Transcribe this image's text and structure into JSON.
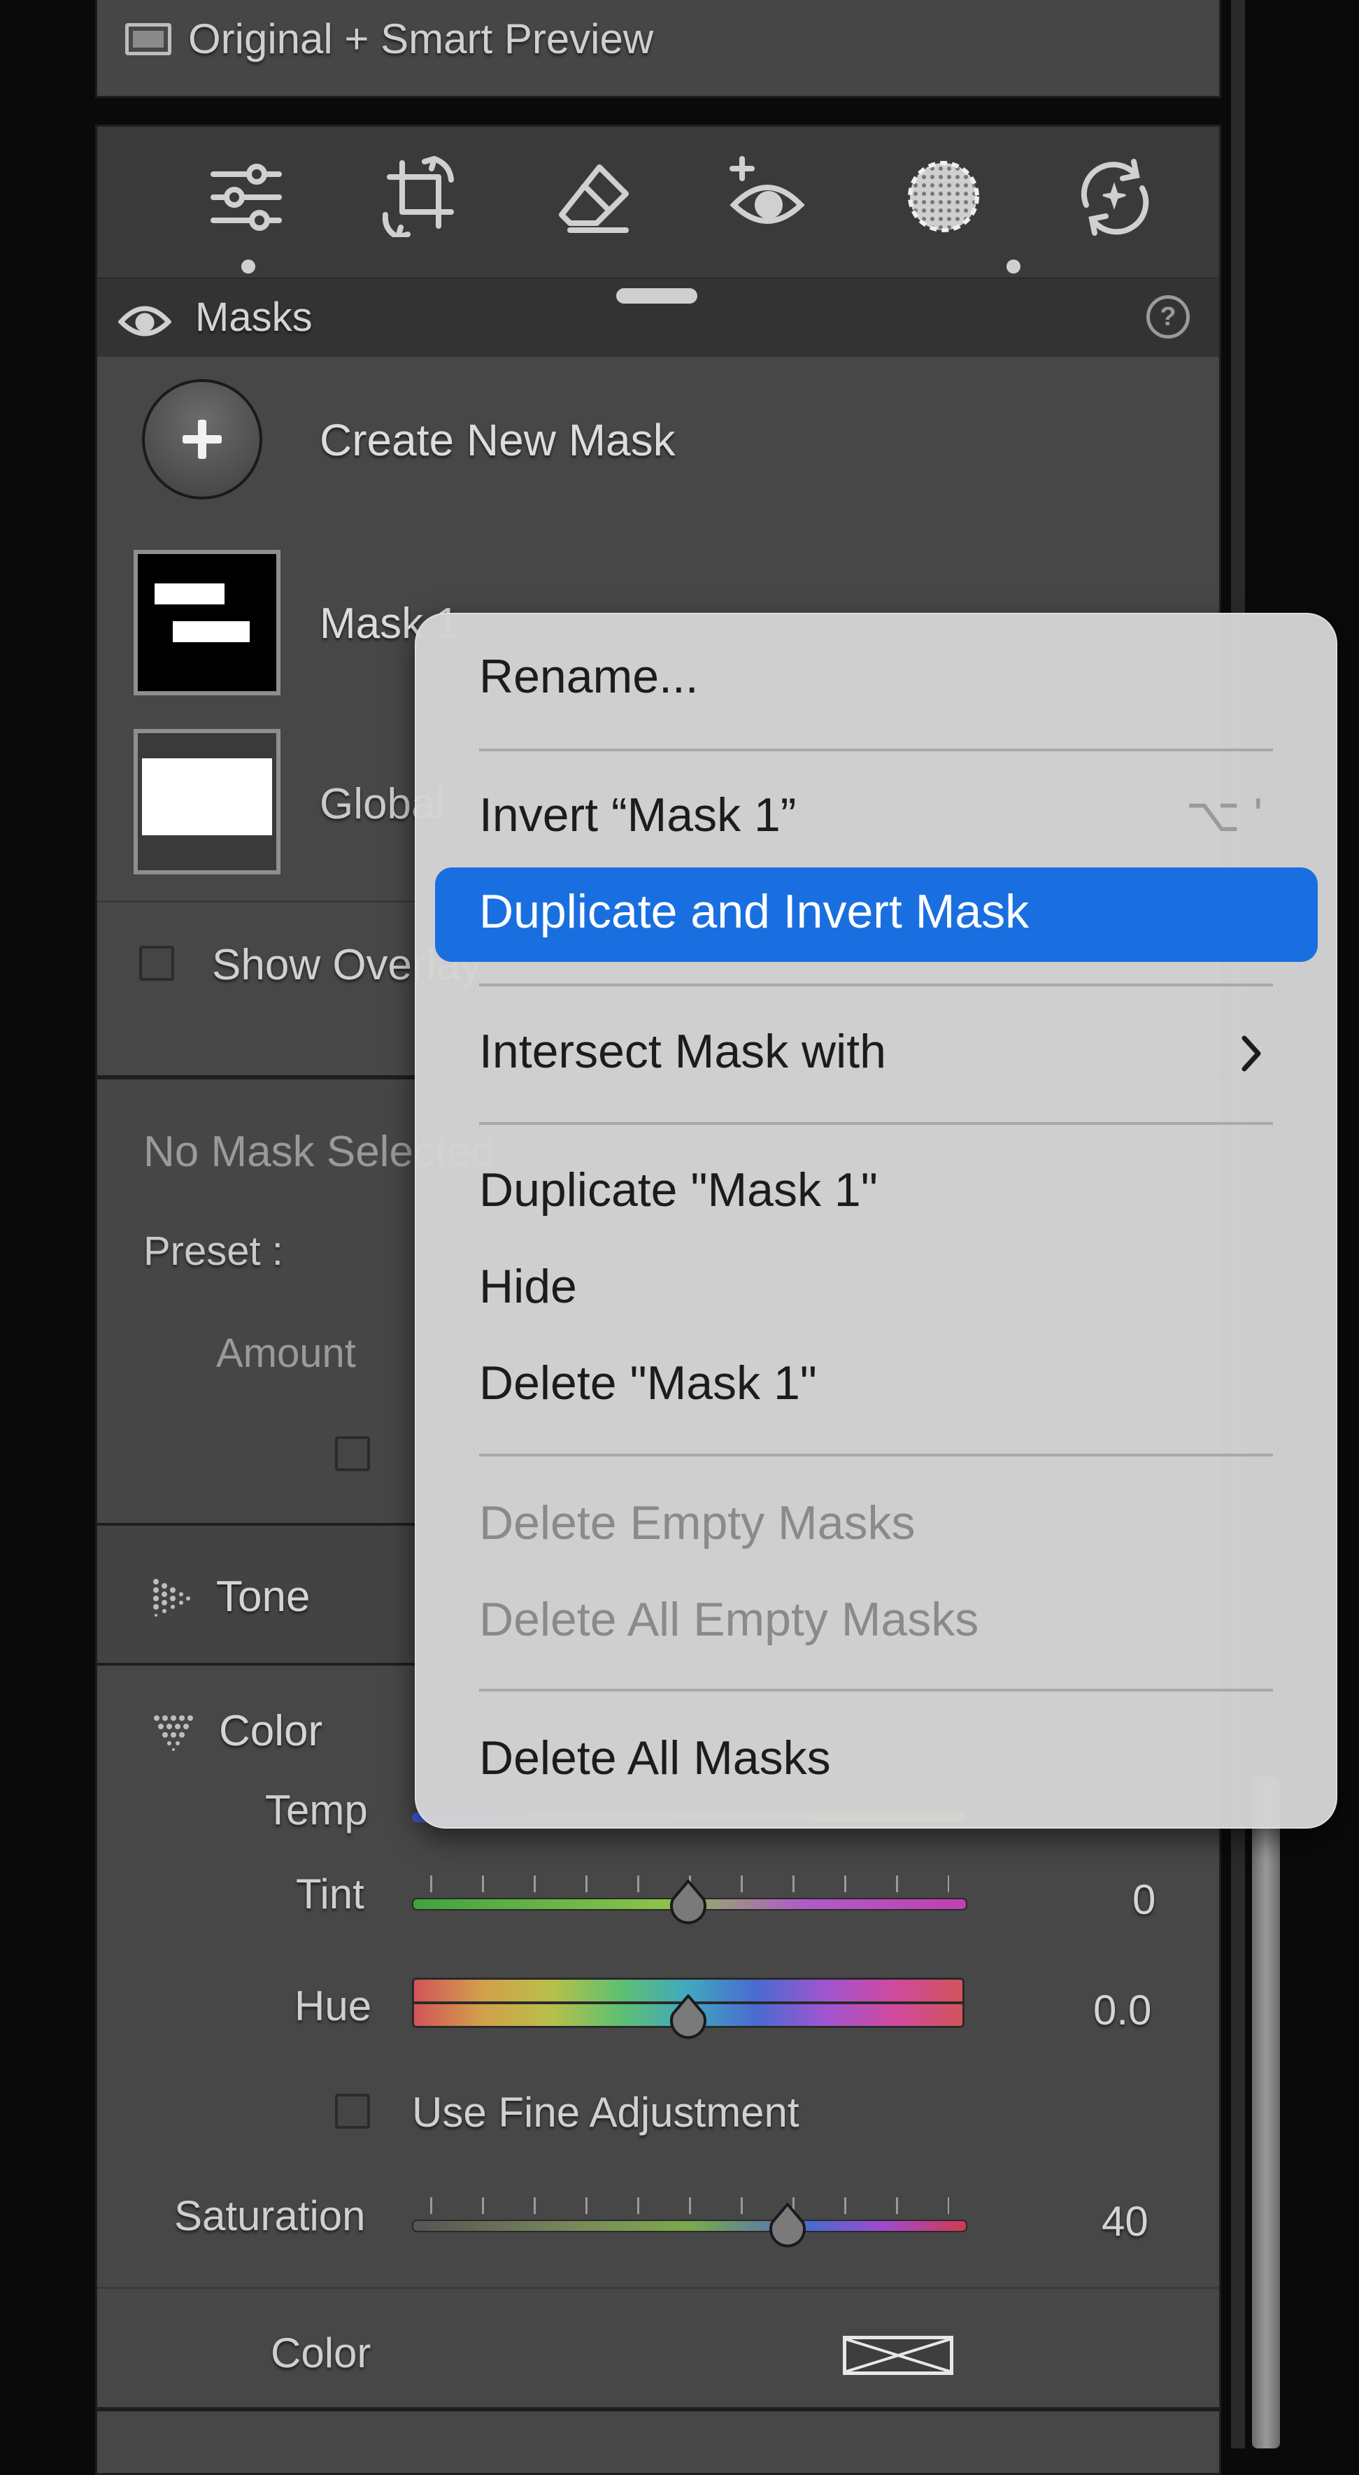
{
  "preview_mode": {
    "label": "Original + Smart Preview"
  },
  "toolbar": {
    "tools": [
      {
        "name": "edit",
        "icon": "sliders-icon"
      },
      {
        "name": "crop",
        "icon": "crop-icon"
      },
      {
        "name": "heal",
        "icon": "eraser-icon"
      },
      {
        "name": "red_eye",
        "icon": "red-eye-icon"
      },
      {
        "name": "masking",
        "icon": "mask-circle-icon"
      },
      {
        "name": "presets",
        "icon": "versions-icon"
      }
    ]
  },
  "masks_panel": {
    "title": "Masks",
    "create_label": "Create New Mask",
    "items": [
      {
        "label": "Mask 1"
      },
      {
        "label": "Global"
      }
    ],
    "show_overlay_label": "Show Overlay"
  },
  "settings": {
    "no_mask_label": "No Mask Selected",
    "preset_label": "Preset :",
    "amount_label": "Amount"
  },
  "tone_section": {
    "title": "Tone"
  },
  "color_section": {
    "title": "Color",
    "temp_label": "Temp",
    "tint_label": "Tint",
    "tint_value": "0",
    "tint_level": 0.5,
    "hue_label": "Hue",
    "hue_value": "0.0",
    "hue_level": 0.5,
    "fine_adjust_label": "Use Fine Adjustment",
    "saturation_label": "Saturation",
    "saturation_value": "40",
    "saturation_level": 0.68,
    "color_label": "Color"
  },
  "context_menu": {
    "rename": "Rename...",
    "invert": "Invert “Mask 1”",
    "invert_shortcut": "⌥ '",
    "duplicate_invert": "Duplicate and Invert Mask",
    "intersect": "Intersect Mask with",
    "duplicate": "Duplicate \"Mask 1\"",
    "hide": "Hide",
    "delete": "Delete \"Mask 1\"",
    "delete_empty": "Delete Empty Masks",
    "delete_all_empty": "Delete All Empty Masks",
    "delete_all": "Delete All Masks"
  },
  "colors": {
    "accent": "#1a6fe0",
    "panel": "#4a4a4a",
    "panel_dark": "#383838"
  }
}
